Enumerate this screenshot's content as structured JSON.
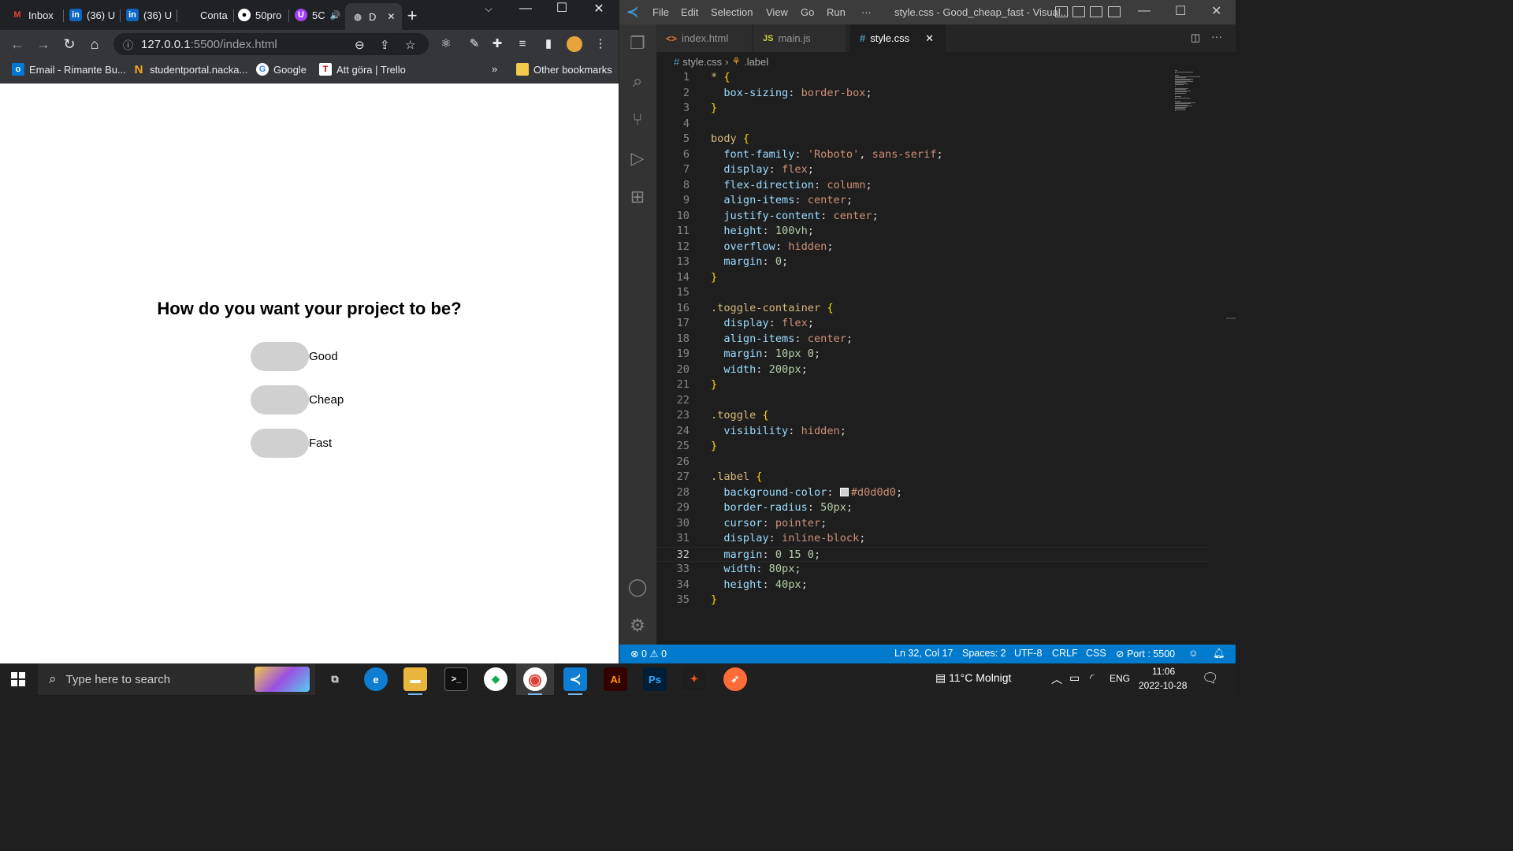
{
  "chrome": {
    "tabs": [
      {
        "label": "Inbox",
        "icon": "gmail-icon"
      },
      {
        "label": "(36) U",
        "icon": "linkedin-icon"
      },
      {
        "label": "(36) U",
        "icon": "linkedin-icon"
      },
      {
        "label": "Conta",
        "icon": "none"
      },
      {
        "label": "50pro",
        "icon": "github-icon"
      },
      {
        "label": "5C",
        "icon": "purple-app-icon"
      },
      {
        "label": "D",
        "icon": "globe-icon",
        "active": true
      }
    ],
    "new_tab": "+",
    "window_controls": {
      "minimize": "—",
      "maximize": "☐",
      "close": "✕"
    },
    "url_host": "127.0.0.1",
    "url_path": ":5500/index.html",
    "bookmarks": [
      {
        "label": "Email - Rimante Bu...",
        "icon": "outlook-icon"
      },
      {
        "label": "studentportal.nacka...",
        "icon": "nacka-icon"
      },
      {
        "label": "Google",
        "icon": "google-icon"
      },
      {
        "label": "Att göra | Trello",
        "icon": "trello-icon"
      }
    ],
    "bookmarks_overflow": "»",
    "other_bookmarks": "Other bookmarks"
  },
  "page": {
    "heading": "How do you want your project to be?",
    "toggles": [
      {
        "label": "Good"
      },
      {
        "label": "Cheap"
      },
      {
        "label": "Fast"
      }
    ]
  },
  "vscode": {
    "menu": [
      "File",
      "Edit",
      "Selection",
      "View",
      "Go",
      "Run",
      "···"
    ],
    "title": "style.css - Good_cheap_fast - Visual...",
    "tabs": [
      {
        "label": "index.html",
        "icon": "<>"
      },
      {
        "label": "main.js",
        "icon": "JS"
      },
      {
        "label": "style.css",
        "icon": "#",
        "active": true
      }
    ],
    "breadcrumb": {
      "file": "style.css",
      "symbol": ".label"
    },
    "current_line": 32,
    "code_lines": [
      [
        {
          "t": "* ",
          "c": "sel"
        },
        {
          "t": "{",
          "c": "brace"
        }
      ],
      [
        {
          "t": "  box-sizing",
          "c": "prop"
        },
        {
          "t": ": ",
          "c": "punc"
        },
        {
          "t": "border-box",
          "c": "val"
        },
        {
          "t": ";",
          "c": "punc"
        }
      ],
      [
        {
          "t": "}",
          "c": "brace"
        }
      ],
      [],
      [
        {
          "t": "body ",
          "c": "sel"
        },
        {
          "t": "{",
          "c": "brace"
        }
      ],
      [
        {
          "t": "  font-family",
          "c": "prop"
        },
        {
          "t": ": ",
          "c": "punc"
        },
        {
          "t": "'Roboto'",
          "c": "val"
        },
        {
          "t": ", ",
          "c": "punc"
        },
        {
          "t": "sans-serif",
          "c": "val"
        },
        {
          "t": ";",
          "c": "punc"
        }
      ],
      [
        {
          "t": "  display",
          "c": "prop"
        },
        {
          "t": ": ",
          "c": "punc"
        },
        {
          "t": "flex",
          "c": "val"
        },
        {
          "t": ";",
          "c": "punc"
        }
      ],
      [
        {
          "t": "  flex-direction",
          "c": "prop"
        },
        {
          "t": ": ",
          "c": "punc"
        },
        {
          "t": "column",
          "c": "val"
        },
        {
          "t": ";",
          "c": "punc"
        }
      ],
      [
        {
          "t": "  align-items",
          "c": "prop"
        },
        {
          "t": ": ",
          "c": "punc"
        },
        {
          "t": "center",
          "c": "val"
        },
        {
          "t": ";",
          "c": "punc"
        }
      ],
      [
        {
          "t": "  justify-content",
          "c": "prop"
        },
        {
          "t": ": ",
          "c": "punc"
        },
        {
          "t": "center",
          "c": "val"
        },
        {
          "t": ";",
          "c": "punc"
        }
      ],
      [
        {
          "t": "  height",
          "c": "prop"
        },
        {
          "t": ": ",
          "c": "punc"
        },
        {
          "t": "100vh",
          "c": "num"
        },
        {
          "t": ";",
          "c": "punc"
        }
      ],
      [
        {
          "t": "  overflow",
          "c": "prop"
        },
        {
          "t": ": ",
          "c": "punc"
        },
        {
          "t": "hidden",
          "c": "val"
        },
        {
          "t": ";",
          "c": "punc"
        }
      ],
      [
        {
          "t": "  margin",
          "c": "prop"
        },
        {
          "t": ": ",
          "c": "punc"
        },
        {
          "t": "0",
          "c": "num"
        },
        {
          "t": ";",
          "c": "punc"
        }
      ],
      [
        {
          "t": "}",
          "c": "brace"
        }
      ],
      [],
      [
        {
          "t": ".toggle-container ",
          "c": "sel"
        },
        {
          "t": "{",
          "c": "brace"
        }
      ],
      [
        {
          "t": "  display",
          "c": "prop"
        },
        {
          "t": ": ",
          "c": "punc"
        },
        {
          "t": "flex",
          "c": "val"
        },
        {
          "t": ";",
          "c": "punc"
        }
      ],
      [
        {
          "t": "  align-items",
          "c": "prop"
        },
        {
          "t": ": ",
          "c": "punc"
        },
        {
          "t": "center",
          "c": "val"
        },
        {
          "t": ";",
          "c": "punc"
        }
      ],
      [
        {
          "t": "  margin",
          "c": "prop"
        },
        {
          "t": ": ",
          "c": "punc"
        },
        {
          "t": "10px 0",
          "c": "num"
        },
        {
          "t": ";",
          "c": "punc"
        }
      ],
      [
        {
          "t": "  width",
          "c": "prop"
        },
        {
          "t": ": ",
          "c": "punc"
        },
        {
          "t": "200px",
          "c": "num"
        },
        {
          "t": ";",
          "c": "punc"
        }
      ],
      [
        {
          "t": "}",
          "c": "brace"
        }
      ],
      [],
      [
        {
          "t": ".toggle ",
          "c": "sel"
        },
        {
          "t": "{",
          "c": "brace"
        }
      ],
      [
        {
          "t": "  visibility",
          "c": "prop"
        },
        {
          "t": ": ",
          "c": "punc"
        },
        {
          "t": "hidden",
          "c": "val"
        },
        {
          "t": ";",
          "c": "punc"
        }
      ],
      [
        {
          "t": "}",
          "c": "brace"
        }
      ],
      [],
      [
        {
          "t": ".label ",
          "c": "sel"
        },
        {
          "t": "{",
          "c": "brace"
        }
      ],
      [
        {
          "t": "  background-color",
          "c": "prop"
        },
        {
          "t": ": ",
          "c": "punc"
        },
        {
          "t": "SWATCH",
          "c": "swatch"
        },
        {
          "t": "#d0d0d0",
          "c": "val"
        },
        {
          "t": ";",
          "c": "punc"
        }
      ],
      [
        {
          "t": "  border-radius",
          "c": "prop"
        },
        {
          "t": ": ",
          "c": "punc"
        },
        {
          "t": "50px",
          "c": "num"
        },
        {
          "t": ";",
          "c": "punc"
        }
      ],
      [
        {
          "t": "  cursor",
          "c": "prop"
        },
        {
          "t": ": ",
          "c": "punc"
        },
        {
          "t": "pointer",
          "c": "val"
        },
        {
          "t": ";",
          "c": "punc"
        }
      ],
      [
        {
          "t": "  display",
          "c": "prop"
        },
        {
          "t": ": ",
          "c": "punc"
        },
        {
          "t": "inline-block",
          "c": "val"
        },
        {
          "t": ";",
          "c": "punc"
        }
      ],
      [
        {
          "t": "  margin",
          "c": "prop"
        },
        {
          "t": ": ",
          "c": "punc"
        },
        {
          "t": "0 15 0",
          "c": "num"
        },
        {
          "t": ";",
          "c": "punc"
        }
      ],
      [
        {
          "t": "  width",
          "c": "prop"
        },
        {
          "t": ": ",
          "c": "punc"
        },
        {
          "t": "80px",
          "c": "num"
        },
        {
          "t": ";",
          "c": "punc"
        }
      ],
      [
        {
          "t": "  height",
          "c": "prop"
        },
        {
          "t": ": ",
          "c": "punc"
        },
        {
          "t": "40px",
          "c": "num"
        },
        {
          "t": ";",
          "c": "punc"
        }
      ],
      [
        {
          "t": "}",
          "c": "brace"
        }
      ]
    ],
    "status": {
      "errors": "0",
      "warnings": "0",
      "position": "Ln 32, Col 17",
      "spaces": "Spaces: 2",
      "encoding": "UTF-8",
      "eol": "CRLF",
      "language": "CSS",
      "port": "Port : 5500"
    }
  },
  "taskbar": {
    "search_placeholder": "Type here to search",
    "apps": [
      {
        "name": "task-view",
        "label": "⧉"
      },
      {
        "name": "edge",
        "label": "e"
      },
      {
        "name": "file-explorer",
        "label": "▬"
      },
      {
        "name": "terminal",
        "label": ">_"
      },
      {
        "name": "mongodb",
        "label": "◆"
      },
      {
        "name": "chrome",
        "label": "◉"
      },
      {
        "name": "vscode",
        "label": "≺"
      },
      {
        "name": "illustrator",
        "label": "Ai"
      },
      {
        "name": "photoshop",
        "label": "Ps"
      },
      {
        "name": "figma",
        "label": "✦"
      },
      {
        "name": "postman",
        "label": "➶"
      }
    ],
    "weather": "11°C Molnigt",
    "language": "ENG",
    "time": "11:06",
    "date": "2022-10-28"
  },
  "colors": {
    "toggle_bg": "#d0d0d0",
    "vscode_status": "#007acc",
    "chrome_dark": "#202124"
  }
}
